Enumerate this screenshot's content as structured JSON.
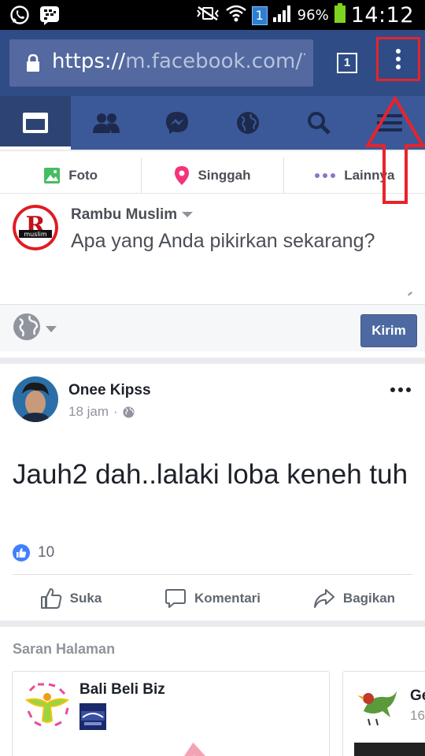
{
  "status_bar": {
    "time": "14:12",
    "battery_percent": "96%",
    "notification_badge": "1"
  },
  "browser": {
    "url_scheme": "https://",
    "url_rest": "m.facebook.com/?_rdr",
    "tab_count": "1",
    "highlight_color": "#e8232b"
  },
  "fb_nav": {
    "tabs": [
      "news-feed",
      "friend-requests",
      "messenger",
      "notifications",
      "search",
      "menu"
    ],
    "active": "news-feed",
    "brand_color": "#3b5998"
  },
  "composer": {
    "actions": [
      {
        "label": "Foto",
        "icon": "photo-icon"
      },
      {
        "label": "Singgah",
        "icon": "checkin-icon"
      },
      {
        "label": "Lainnya",
        "icon": "more-dots-icon"
      }
    ],
    "user_name": "Rambu Muslim",
    "avatar_logo_letter": "R",
    "avatar_logo_word": "muslim",
    "placeholder": "Apa yang Anda pikirkan sekarang?",
    "submit_label": "Kirim"
  },
  "post": {
    "author": "Onee Kipss",
    "time": "18 jam",
    "text": "Jauh2 dah..lalaki loba keneh tuh",
    "like_count": "10",
    "actions": [
      {
        "label": "Suka",
        "icon": "thumbs-up-icon"
      },
      {
        "label": "Komentari",
        "icon": "comment-icon"
      },
      {
        "label": "Bagikan",
        "icon": "share-icon"
      }
    ]
  },
  "suggestions": {
    "title": "Saran Halaman",
    "cards": [
      {
        "name": "Bali Beli Biz"
      },
      {
        "name": "Ge",
        "sub": "16"
      }
    ]
  }
}
